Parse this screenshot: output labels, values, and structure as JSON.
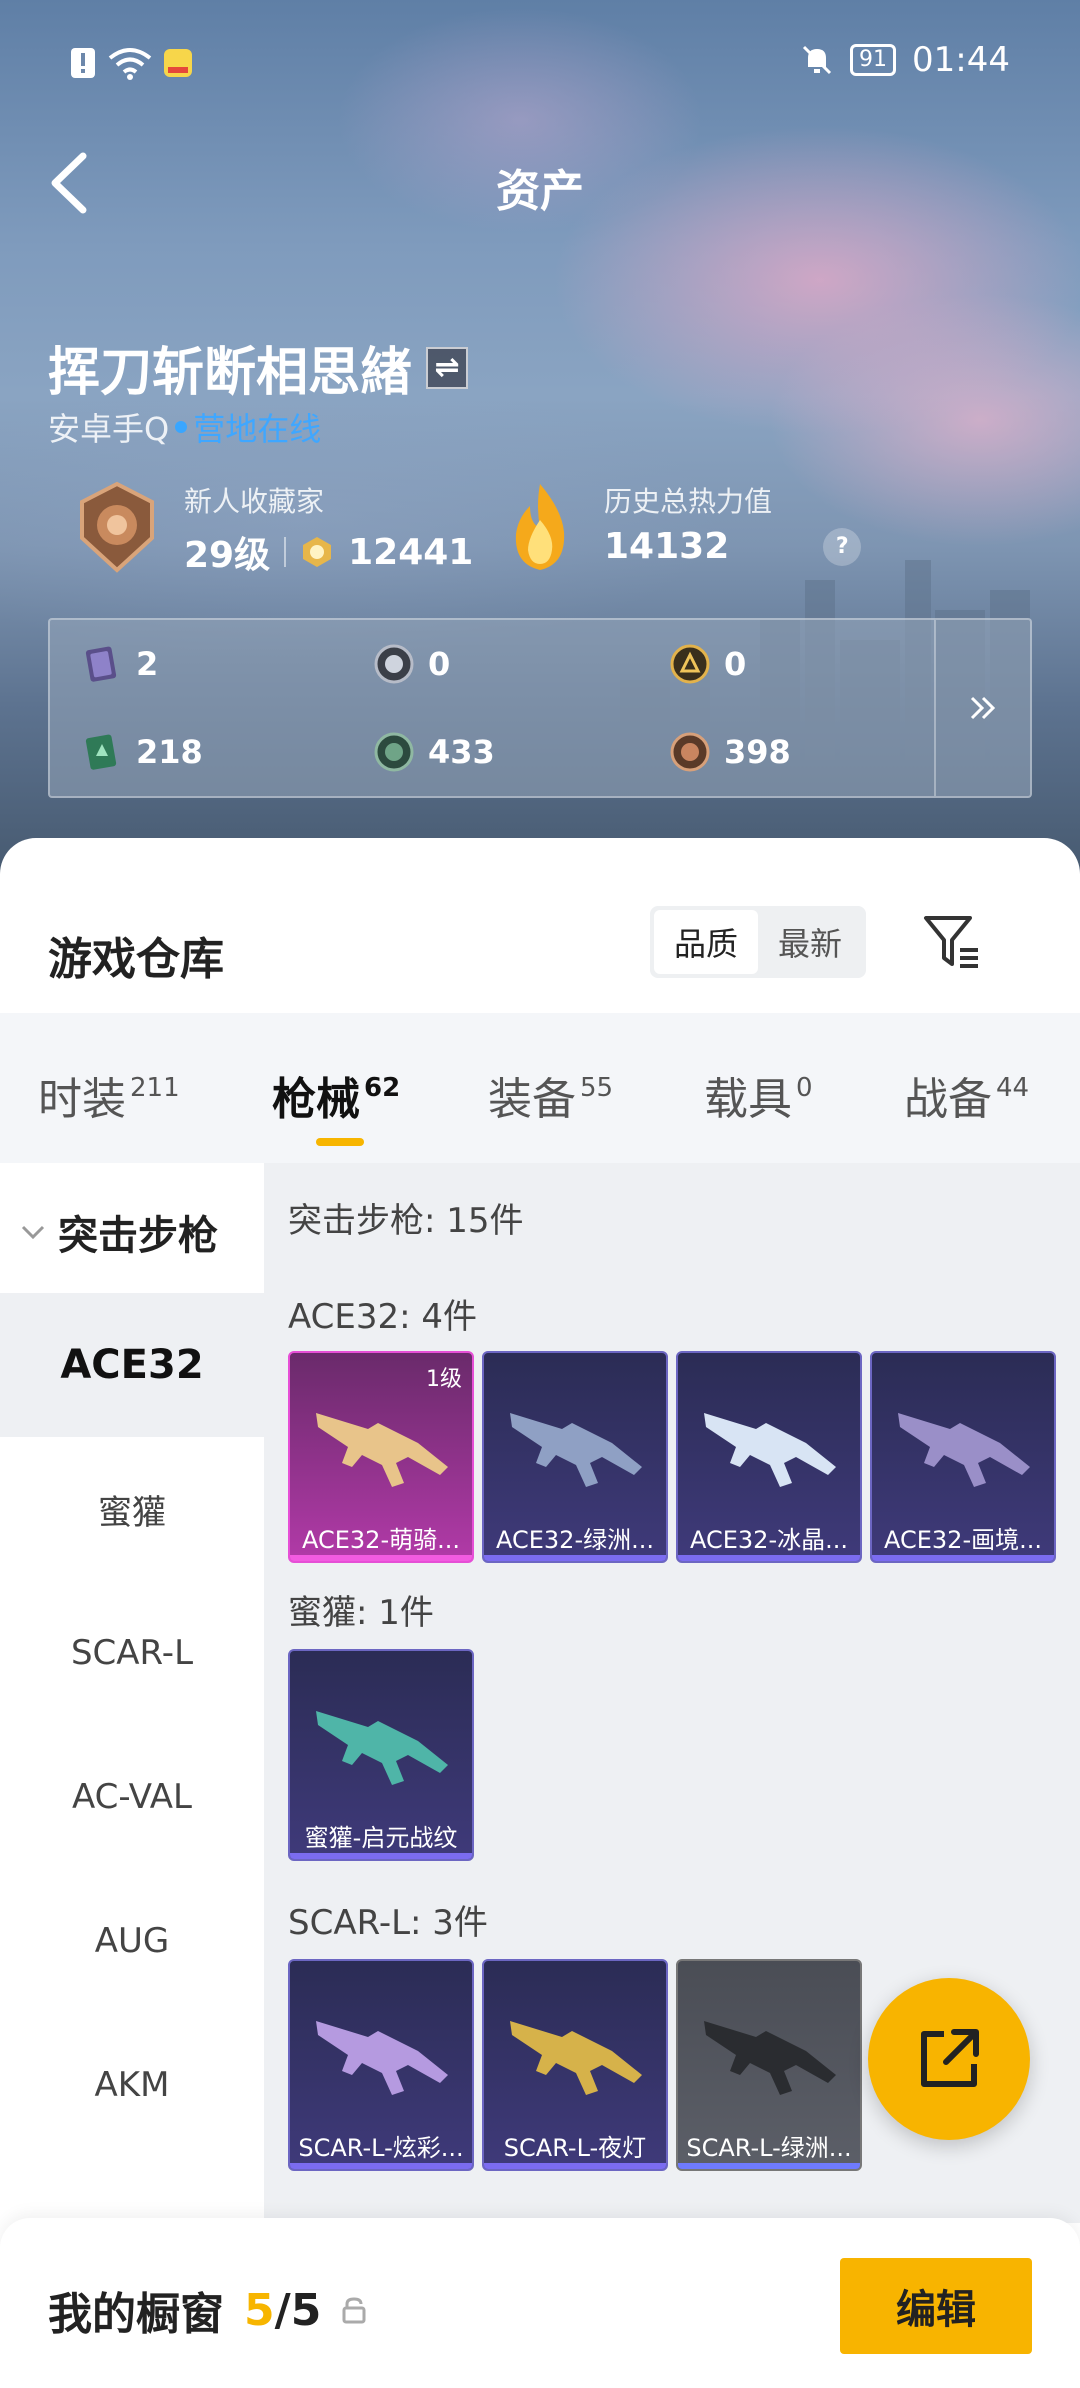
{
  "status": {
    "time": "01:44",
    "battery": "91"
  },
  "header": {
    "title": "资产"
  },
  "profile": {
    "name": "挥刀斩断相思緖",
    "platform": "安卓手Q",
    "online_status": "营地在线",
    "collector_title": "新人收藏家",
    "level": "29级",
    "collector_points": "12441",
    "heat_label": "历史总热力值",
    "heat_value": "14132",
    "help_symbol": "?"
  },
  "assets": [
    {
      "icon": "purple-card-icon",
      "value": "2"
    },
    {
      "icon": "silver-coin-icon",
      "value": "0"
    },
    {
      "icon": "gold-coin-icon",
      "value": "0"
    },
    {
      "icon": "green-card-icon",
      "value": "218"
    },
    {
      "icon": "green-coin-icon",
      "value": "433"
    },
    {
      "icon": "bronze-coin-icon",
      "value": "398"
    }
  ],
  "warehouse": {
    "title": "游戏仓库",
    "sort_options": [
      "品质",
      "最新"
    ],
    "tabs": [
      {
        "label": "时装",
        "count": "211"
      },
      {
        "label": "枪械",
        "count": "62"
      },
      {
        "label": "装备",
        "count": "55"
      },
      {
        "label": "载具",
        "count": "0"
      },
      {
        "label": "战备",
        "count": "44"
      }
    ],
    "category": "突击步枪",
    "sidebar": [
      "ACE32",
      "蜜獾",
      "SCAR-L",
      "AC-VAL",
      "AUG",
      "AKM"
    ],
    "summary": "突击步枪: 15件",
    "groups": [
      {
        "title": "ACE32: 4件",
        "items": [
          {
            "name": "ACE32-萌骑...",
            "level": "1级"
          },
          {
            "name": "ACE32-绿洲..."
          },
          {
            "name": "ACE32-冰晶..."
          },
          {
            "name": "ACE32-画境..."
          }
        ]
      },
      {
        "title": "蜜獾: 1件",
        "items": [
          {
            "name": "蜜獾-启元战纹"
          }
        ]
      },
      {
        "title": "SCAR-L: 3件",
        "items": [
          {
            "name": "SCAR-L-炫彩..."
          },
          {
            "name": "SCAR-L-夜灯"
          },
          {
            "name": "SCAR-L-绿洲..."
          }
        ]
      }
    ]
  },
  "showcase": {
    "title": "我的橱窗",
    "current": "5",
    "separator": "/",
    "total": "5",
    "edit_label": "编辑"
  }
}
